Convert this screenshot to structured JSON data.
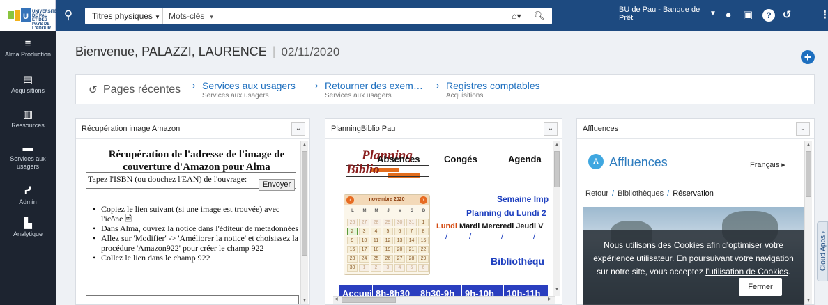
{
  "topbar": {
    "logo_text": "UNIVERSITÉ DE PAU ET DES PAYS DE L'ADOUR",
    "search_type": "Titres physiques",
    "search_field": "Mots-clés",
    "search_value": "",
    "institution": "BU de Pau - Banque de Prêt"
  },
  "sidebar": {
    "items": [
      {
        "label": "Alma Production",
        "icon": "alma-menu-icon"
      },
      {
        "label": "Acquisitions",
        "icon": "acquisitions-icon"
      },
      {
        "label": "Ressources",
        "icon": "resources-icon"
      },
      {
        "label": "Services aux usagers",
        "icon": "user-services-icon"
      },
      {
        "label": "Admin",
        "icon": "admin-icon"
      },
      {
        "label": "Analytique",
        "icon": "analytics-icon"
      }
    ]
  },
  "header": {
    "welcome": "Bienvenue, PALAZZI, LAURENCE",
    "date": "02/11/2020"
  },
  "recent_pages": {
    "title": "Pages récentes",
    "links": [
      {
        "main": "Services aux usagers",
        "sub": "Services aux usagers"
      },
      {
        "main": "Retourner des exem…",
        "sub": "Services aux usagers"
      },
      {
        "main": "Registres comptables",
        "sub": "Acquisitions"
      }
    ]
  },
  "widgets": {
    "amazon": {
      "title": "Récupération image Amazon",
      "heading": "Récupération de l'adresse de l'image de couverture d'Amazon pour Alma",
      "form_label": "Tapez l'ISBN (ou douchez l'EAN) de l'ouvrage:",
      "button": "Envoyer",
      "list": [
        "Copiez le lien suivant (si une image est trouvée) avec l'icône",
        "Dans Alma, ouvrez la notice dans l'éditeur de métadonnées",
        "Allez sur 'Modifier' -> 'Améliorer la notice' et choisissez la procédure 'Amazon922' pour créer le champ 922",
        "Collez le lien dans le champ 922"
      ]
    },
    "planning": {
      "title": "PlanningBiblio Pau",
      "logo_word1": "Planning",
      "logo_word2": "Biblio",
      "tabs": [
        "Absences",
        "Congés",
        "Agenda"
      ],
      "calendar_month": "novembre 2020",
      "dow": [
        "L",
        "M",
        "M",
        "J",
        "V",
        "S",
        "D"
      ],
      "calendar_rows": [
        [
          "26",
          "27",
          "28",
          "29",
          "30",
          "31",
          "1"
        ],
        [
          "2",
          "3",
          "4",
          "5",
          "6",
          "7",
          "8"
        ],
        [
          "9",
          "10",
          "11",
          "12",
          "13",
          "14",
          "15"
        ],
        [
          "16",
          "17",
          "18",
          "19",
          "20",
          "21",
          "22"
        ],
        [
          "23",
          "24",
          "25",
          "26",
          "27",
          "28",
          "29"
        ],
        [
          "30",
          "1",
          "2",
          "3",
          "4",
          "5",
          "6"
        ]
      ],
      "week_line1": "Semaine Imp",
      "week_line2": "Planning du Lundi 2",
      "day_lundi": "Lundi",
      "days_rest": "Mardi Mercredi Jeudi V",
      "biblio": "Bibliothèqu",
      "accueil": "Accueil",
      "slots": [
        "8h-8h30",
        "8h30-9h",
        "9h-10h",
        "10h-11h"
      ]
    },
    "affluences": {
      "title": "Affluences",
      "logo_letter": "A",
      "name": "Affluences",
      "lang": "Français",
      "crumb": [
        "Retour",
        "Bibliothèques",
        "Réservation"
      ],
      "cookie_text_1": "Nous utilisons des Cookies afin d'optimiser votre expérience utilisateur. En poursuivant votre navigation sur notre site, vous acceptez ",
      "cookie_link": "l'utilisation de Cookies",
      "cookie_text_2": ".",
      "cookie_button": "Fermer"
    }
  },
  "cloud_apps": "Cloud Apps"
}
